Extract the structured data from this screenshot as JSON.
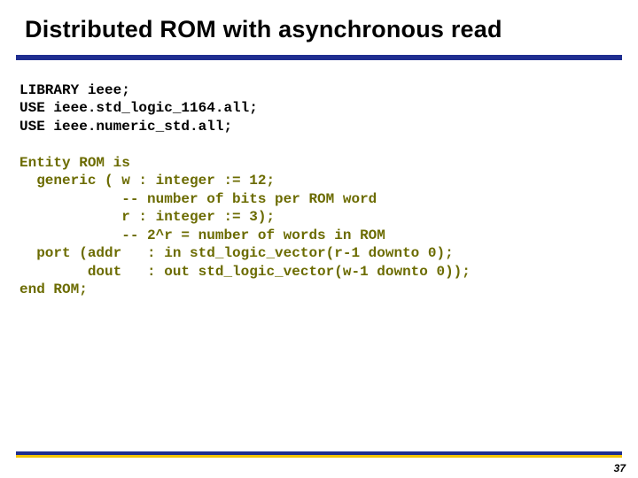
{
  "title": "Distributed ROM with asynchronous read",
  "code": {
    "lib1": "LIBRARY ieee;",
    "lib2": "USE ieee.std_logic_1164.all;",
    "lib3": "USE ieee.numeric_std.all;",
    "ent1": "Entity ROM is",
    "ent2": "  generic ( w : integer := 12;",
    "ent3": "            -- number of bits per ROM word",
    "ent4": "            r : integer := 3);",
    "ent5": "            -- 2^r = number of words in ROM",
    "ent6": "  port (addr   : in std_logic_vector(r-1 downto 0);",
    "ent7": "        dout   : out std_logic_vector(w-1 downto 0));",
    "ent8": "end ROM;"
  },
  "page_number": "37"
}
